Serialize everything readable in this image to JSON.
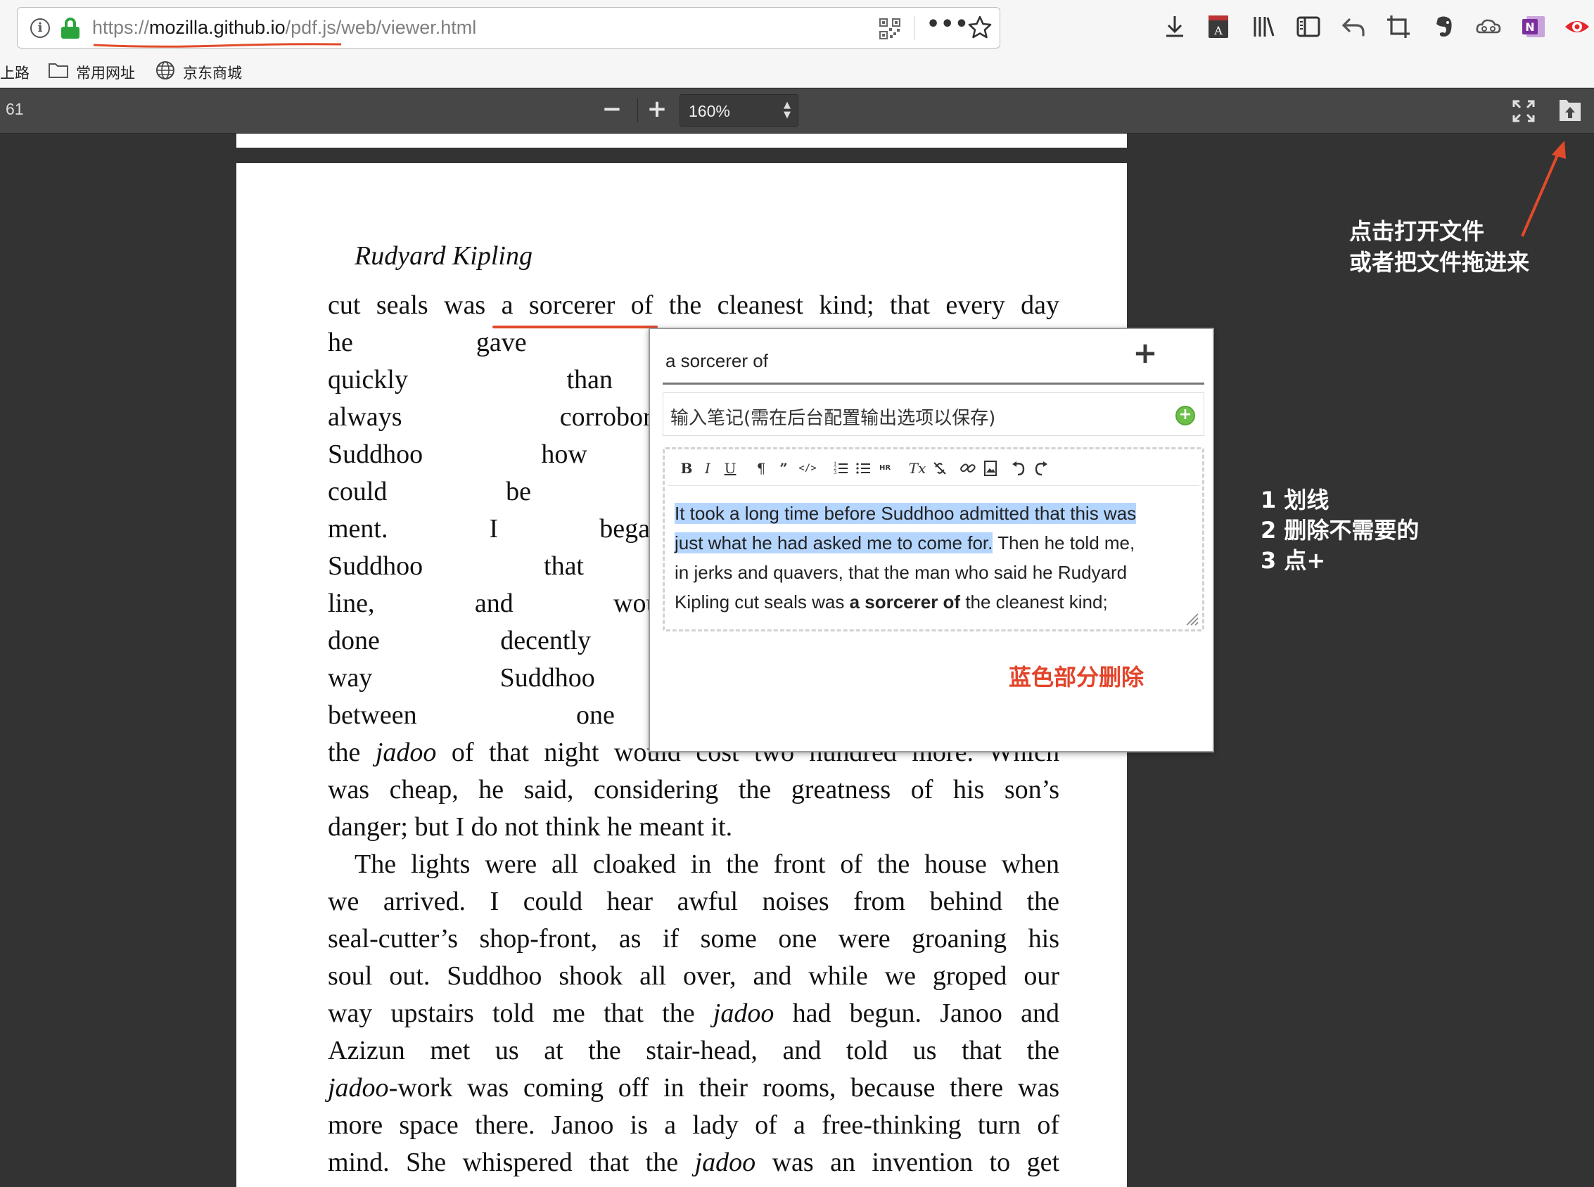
{
  "browser": {
    "url_prefix": "https://",
    "url_host": "mozilla.github.io",
    "url_path": "/pdf.js/web/viewer.html",
    "accent_underline": "#e14b2a",
    "bookmarks": [
      "上路",
      "常用网址",
      "京东商城"
    ]
  },
  "viewer": {
    "page_number": "61",
    "zoom_out_label": "−",
    "zoom_in_label": "+",
    "zoom_value": "160%"
  },
  "page": {
    "running_head": "Rudyard Kipling",
    "lines": [
      "cut seals was a sorcerer of the cleanest kind; that every day",
      "he gave Suddhoo news o",
      "quickly than the lightning",
      "always corroborated by th",
      "Suddhoo how a great dang",
      "could be removed by clear",
      "ment. I began to see exa",
      "Suddhoo that I also under",
      "line, and would go to his",
      "done decently and in orde",
      "way Suddhoo told me t",
      "between one hundred and",
      "the jadoo of that night would cost two hundred more. Which",
      "was cheap, he said, considering the greatness of his son’s",
      "danger; but I do not think he meant it.",
      "The lights were all cloaked in the front of the house when",
      "we arrived. I could hear awful noises from behind the",
      "seal-cutter’s shop-front, as if some one were groaning his",
      "soul out. Suddhoo shook all over, and while we groped our",
      "way upstairs told me that the jadoo had begun. Janoo and",
      "Azizun met us at the stair-head, and told us that the",
      "jadoo-work was coming off in their rooms, because there was",
      "more space there. Janoo is a lady of a free-thinking turn of",
      "mind. She whispered that the jadoo was an invention to get"
    ]
  },
  "note_popup": {
    "quote": "a sorcerer of",
    "add_label": "+",
    "note_placeholder": "输入笔记(需在后台配置输出选项以保存)",
    "toolbar": [
      "B",
      "I",
      "U",
      "¶",
      "”",
      "</>",
      "ol",
      "ul",
      "HR",
      "Tx",
      "unlink",
      "link",
      "image",
      "undo",
      "redo"
    ],
    "text_highlighted_1": "It took a long time before Suddhoo admitted that this was",
    "text_highlighted_2": "just what he had asked me to come for.",
    "text_rest_2": " Then he told me,",
    "text_line_3": "in jerks and quavers, that the man who said he Rudyard",
    "text_line_4_a": "Kipling cut seals was ",
    "text_line_4_bold": "a sorcerer of",
    "text_line_4_b": " the cleanest kind;",
    "highlight_color": "#b4d5fe",
    "red_note": "蓝色部分删除",
    "red_color": "#e3442a"
  },
  "annotations": {
    "open_file_1": "点击打开文件",
    "open_file_2": "或者把文件拖进来",
    "step_1": "1 划线",
    "step_2": "2 删除不需要的",
    "step_3": "3 点+"
  }
}
